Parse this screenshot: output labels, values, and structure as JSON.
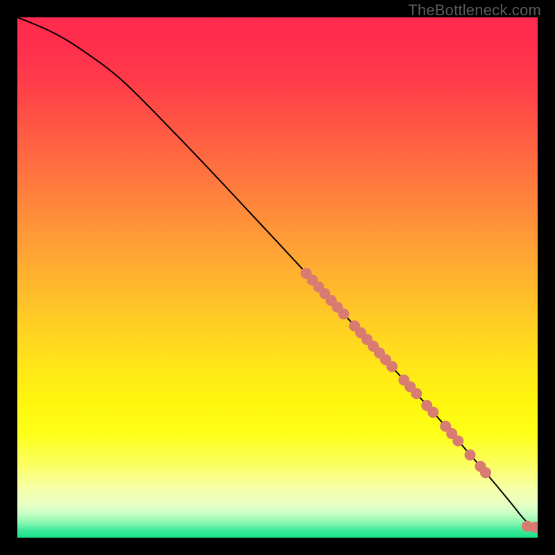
{
  "attribution": "TheBottleneck.com",
  "chart_data": {
    "type": "line",
    "title": "",
    "xlabel": "",
    "ylabel": "",
    "x_range": [
      0,
      100
    ],
    "y_range": [
      0,
      100
    ],
    "curve": {
      "x": [
        0,
        3,
        7,
        12,
        20,
        30,
        40,
        50,
        60,
        70,
        80,
        90,
        95,
        97,
        99,
        100
      ],
      "y": [
        100,
        98.8,
        97,
        94,
        88,
        78,
        67.5,
        56.8,
        46,
        35,
        24,
        12.5,
        6.5,
        4,
        2,
        2
      ]
    },
    "markers": {
      "color": "#d87b71",
      "radius_px": 8,
      "points": [
        {
          "x": 55.5,
          "y": 50.8
        },
        {
          "x": 56.7,
          "y": 49.5
        },
        {
          "x": 57.9,
          "y": 48.2
        },
        {
          "x": 59.1,
          "y": 46.9
        },
        {
          "x": 60.3,
          "y": 45.6
        },
        {
          "x": 61.5,
          "y": 44.3
        },
        {
          "x": 62.7,
          "y": 43.0
        },
        {
          "x": 64.8,
          "y": 40.7
        },
        {
          "x": 66.0,
          "y": 39.4
        },
        {
          "x": 67.2,
          "y": 38.1
        },
        {
          "x": 68.4,
          "y": 36.8
        },
        {
          "x": 69.6,
          "y": 35.5
        },
        {
          "x": 70.8,
          "y": 34.2
        },
        {
          "x": 72.0,
          "y": 32.9
        },
        {
          "x": 74.3,
          "y": 30.3
        },
        {
          "x": 75.5,
          "y": 29.0
        },
        {
          "x": 76.7,
          "y": 27.7
        },
        {
          "x": 78.7,
          "y": 25.4
        },
        {
          "x": 79.9,
          "y": 24.1
        },
        {
          "x": 82.3,
          "y": 21.4
        },
        {
          "x": 83.5,
          "y": 20.0
        },
        {
          "x": 84.7,
          "y": 18.6
        },
        {
          "x": 87.0,
          "y": 15.9
        },
        {
          "x": 89.0,
          "y": 13.7
        },
        {
          "x": 90.0,
          "y": 12.5
        },
        {
          "x": 98.0,
          "y": 2.2
        },
        {
          "x": 99.5,
          "y": 2.0
        }
      ]
    },
    "gradient_stops": [
      {
        "offset": 0.0,
        "color": "#ff2a4d"
      },
      {
        "offset": 0.05,
        "color": "#ff2e4d"
      },
      {
        "offset": 0.12,
        "color": "#ff3b4a"
      },
      {
        "offset": 0.22,
        "color": "#ff5a43"
      },
      {
        "offset": 0.33,
        "color": "#ff7d3d"
      },
      {
        "offset": 0.45,
        "color": "#ffa334"
      },
      {
        "offset": 0.56,
        "color": "#ffc627"
      },
      {
        "offset": 0.66,
        "color": "#ffe31a"
      },
      {
        "offset": 0.74,
        "color": "#fff60e"
      },
      {
        "offset": 0.8,
        "color": "#feff17"
      },
      {
        "offset": 0.86,
        "color": "#fbff62"
      },
      {
        "offset": 0.905,
        "color": "#f7ffa8"
      },
      {
        "offset": 0.935,
        "color": "#e8ffc4"
      },
      {
        "offset": 0.955,
        "color": "#c4ffc4"
      },
      {
        "offset": 0.972,
        "color": "#86f7b0"
      },
      {
        "offset": 0.986,
        "color": "#3de998"
      },
      {
        "offset": 1.0,
        "color": "#16e288"
      }
    ]
  }
}
